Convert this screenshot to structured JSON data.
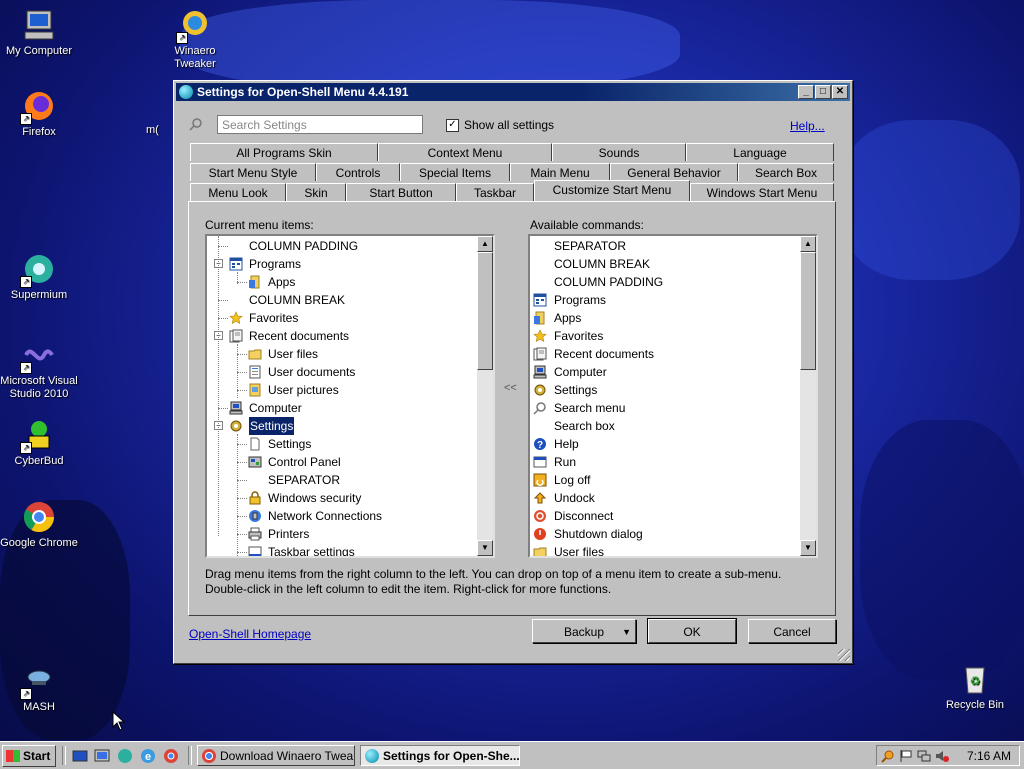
{
  "desktop": {
    "icons": [
      {
        "label": "My Computer"
      },
      {
        "label": "Winaero\nTweaker"
      },
      {
        "label": "Firefox"
      },
      {
        "label": "m("
      },
      {
        "label": "Supermium"
      },
      {
        "label": "Microsoft Visual\nStudio 2010"
      },
      {
        "label": "CyberBud"
      },
      {
        "label": "Google Chrome"
      },
      {
        "label": "MASH"
      },
      {
        "label": "Recycle Bin"
      }
    ]
  },
  "window": {
    "title": "Settings for Open-Shell Menu 4.4.191",
    "search_placeholder": "Search Settings",
    "show_all_label": "Show all settings",
    "show_all_checked": "✓",
    "help_label": "Help...",
    "tabs_row1": [
      "All Programs Skin",
      "Context Menu",
      "Sounds",
      "Language"
    ],
    "tabs_row2": [
      "Start Menu Style",
      "Controls",
      "Special Items",
      "Main Menu",
      "General Behavior",
      "Search Box"
    ],
    "tabs_row3": [
      "Menu Look",
      "Skin",
      "Start Button",
      "Taskbar",
      "Customize Start Menu",
      "Windows Start Menu"
    ],
    "current_label": "Current menu items:",
    "available_label": "Available commands:",
    "current_items": [
      "COLUMN PADDING",
      "Programs",
      "Apps",
      "COLUMN BREAK",
      "Favorites",
      "Recent documents",
      "User files",
      "User documents",
      "User pictures",
      "Computer",
      "Settings",
      "Settings",
      "Control Panel",
      "SEPARATOR",
      "Windows security",
      "Network Connections",
      "Printers",
      "Taskbar settings"
    ],
    "available_items": [
      "SEPARATOR",
      "COLUMN BREAK",
      "COLUMN PADDING",
      "Programs",
      "Apps",
      "Favorites",
      "Recent documents",
      "Computer",
      "Settings",
      "Search menu",
      "Search box",
      "Help",
      "Run",
      "Log off",
      "Undock",
      "Disconnect",
      "Shutdown dialog",
      "User files"
    ],
    "move_arrows": "<<",
    "hint_line1": "Drag menu items from the right column to the left. You can drop on top of a menu item to create a sub-menu.",
    "hint_line2": "Double-click in the left column to edit the item. Right-click for more functions.",
    "homepage_link": "Open-Shell Homepage",
    "backup_label": "Backup",
    "ok_label": "OK",
    "cancel_label": "Cancel"
  },
  "taskbar": {
    "start_label": "Start",
    "items": [
      "Download Winaero Twea...",
      "Settings for Open-She..."
    ],
    "clock": "7:16 AM"
  },
  "colors": {
    "selection": "#0a246a",
    "titlebar": "#0a246a",
    "link": "#0000c0"
  }
}
